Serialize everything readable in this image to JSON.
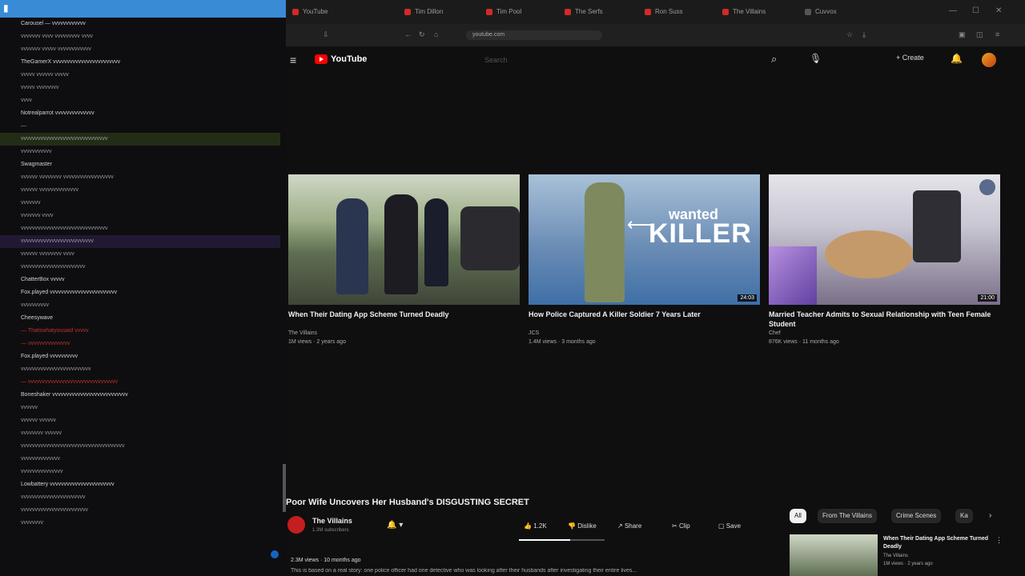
{
  "chat": {
    "lines": [
      {
        "text": "Carousel — vvvvvvvvvvvv",
        "style": "hdr"
      },
      {
        "text": "vvvvvvv vvvv vvvvvvvvv vvvv",
        "style": ""
      },
      {
        "text": "vvvvvvv vvvvv vvvvvvvvvvvv",
        "style": ""
      },
      {
        "text": "TheGamerX  vvvvvvvvvvvvvvvvvvvvvvvv",
        "style": "hdr"
      },
      {
        "text": "vvvvv vvvvvv vvvvv",
        "style": ""
      },
      {
        "text": "vvvvv vvvvvvvv",
        "style": ""
      },
      {
        "text": "vvvv",
        "style": ""
      },
      {
        "text": "Notrealparrot  vvvvvvvvvvvvvv",
        "style": "hdr"
      },
      {
        "text": "—",
        "style": ""
      },
      {
        "text": "vvvvvvvvvvvvvvvvvvvvvvvvvvvvvvv",
        "style": "hl"
      },
      {
        "text": "vvvvvvvvvvv",
        "style": ""
      },
      {
        "text": "Swagmaster",
        "style": "hdr"
      },
      {
        "text": "vvvvvv vvvvvvvv vvvvvvvvvvvvvvvvvv",
        "style": ""
      },
      {
        "text": "vvvvvv vvvvvvvvvvvvvv",
        "style": ""
      },
      {
        "text": "vvvvvvv",
        "style": ""
      },
      {
        "text": "vvvvvvv vvvv",
        "style": ""
      },
      {
        "text": "vvvvvvvvvvvvvvvvvvvvvvvvvvvvvvv",
        "style": ""
      },
      {
        "text": "vvvvvvvvvvvvvvvvvvvvvvvvvv",
        "style": "hl2"
      },
      {
        "text": "vvvvvv vvvvvvvv vvvv",
        "style": ""
      },
      {
        "text": "vvvvvvvvvvvvvvvvvvvvvvv",
        "style": ""
      },
      {
        "text": "ChatterBox  vvvvv",
        "style": "hdr"
      },
      {
        "text": "Fox.played  vvvvvvvvvvvvvvvvvvvvvvvv",
        "style": "hdr"
      },
      {
        "text": "vvvvvvvvvv",
        "style": ""
      },
      {
        "text": "Cheesywave",
        "style": "hdr"
      },
      {
        "text": "— Thatswhatyousaid vvvvv",
        "style": "dash"
      },
      {
        "text": "— vvvvvvvvvvvvvvv",
        "style": "dash"
      },
      {
        "text": "Fox.played  vvvvvvvvvv",
        "style": "hdr"
      },
      {
        "text": "vvvvvvvvvvvvvvvvvvvvvvvvv",
        "style": ""
      },
      {
        "text": "— vvvvvvvvvvvvvvvvvvvvvvvvvvvvvvvv",
        "style": "dash"
      },
      {
        "text": "Boneshaker  vvvvvvvvvvvvvvvvvvvvvvvvvvv",
        "style": "hdr"
      },
      {
        "text": "vvvvvv",
        "style": ""
      },
      {
        "text": "vvvvvv vvvvvv",
        "style": ""
      },
      {
        "text": "vvvvvvvv vvvvvv",
        "style": ""
      },
      {
        "text": "vvvvvvvvvvvvvvvvvvvvvvvvvvvvvvvvvvvvv",
        "style": ""
      },
      {
        "text": "vvvvvvvvvvvvvv",
        "style": ""
      },
      {
        "text": "vvvvvvvvvvvvvvv",
        "style": ""
      },
      {
        "text": "Lowbattery  vvvvvvvvvvvvvvvvvvvvvvv",
        "style": "hdr"
      },
      {
        "text": "vvvvvvvvvvvvvvvvvvvvvvv",
        "style": ""
      },
      {
        "text": "vvvvvvvvvvvvvvvvvvvvvvvv",
        "style": ""
      },
      {
        "text": "vvvvvvvv",
        "style": ""
      }
    ]
  },
  "browser": {
    "tabs": [
      {
        "label": "YouTube"
      },
      {
        "label": "Tim Dillon"
      },
      {
        "label": "Tim Pool"
      },
      {
        "label": "The Serfs"
      },
      {
        "label": "Ron Suss"
      },
      {
        "label": "The Villains"
      },
      {
        "label": "Cuvvox"
      }
    ],
    "url": "youtube.com",
    "window_buttons": {
      "minimize": "—",
      "maximize": "☐",
      "close": "✕"
    }
  },
  "youtube": {
    "brand": "YouTube",
    "search_placeholder": "Search",
    "create_label": "+ Create",
    "end_screen": [
      {
        "title": "When Their Dating App Scheme Turned Deadly",
        "channel": "The Villains",
        "meta": "1M views · 2 years ago",
        "duration": ""
      },
      {
        "title": "How Police Captured A Killer Soldier 7 Years Later",
        "channel": "JCS",
        "meta": "1.4M views · 3 months ago",
        "duration": "24:03",
        "thumb_text_top": "wanted",
        "thumb_text_main": "KILLER"
      },
      {
        "title": "Married Teacher Admits to Sexual Relationship with Teen Female Student",
        "channel": "Chef",
        "meta": "876K views · 11 months ago",
        "duration": "21:00"
      }
    ],
    "video": {
      "title": "Poor Wife Uncovers Her Husband's DISGUSTING SECRET",
      "channel": "The Villains",
      "subscribers": "1.3M subscribers",
      "actions": [
        "1.2K",
        "Dislike",
        "Share",
        "Clip",
        "Save"
      ],
      "like_ratio": 0.6,
      "description_meta": "2.3M views · 10 months ago",
      "description_text": "This is based on a real story: one police officer had one detective who was looking after their husbands after investigating their entire lives..."
    },
    "chips": [
      "All",
      "From The Villains",
      "Crime Scenes",
      "Ka"
    ],
    "related": {
      "title": "When Their Dating App Scheme Turned Deadly",
      "channel": "The Villains",
      "meta": "1M views · 2 years ago"
    }
  },
  "colors": {
    "brand_red": "#ff0000",
    "chat_bg": "#0e0e10",
    "topbar_blue": "#3a8bd6"
  }
}
